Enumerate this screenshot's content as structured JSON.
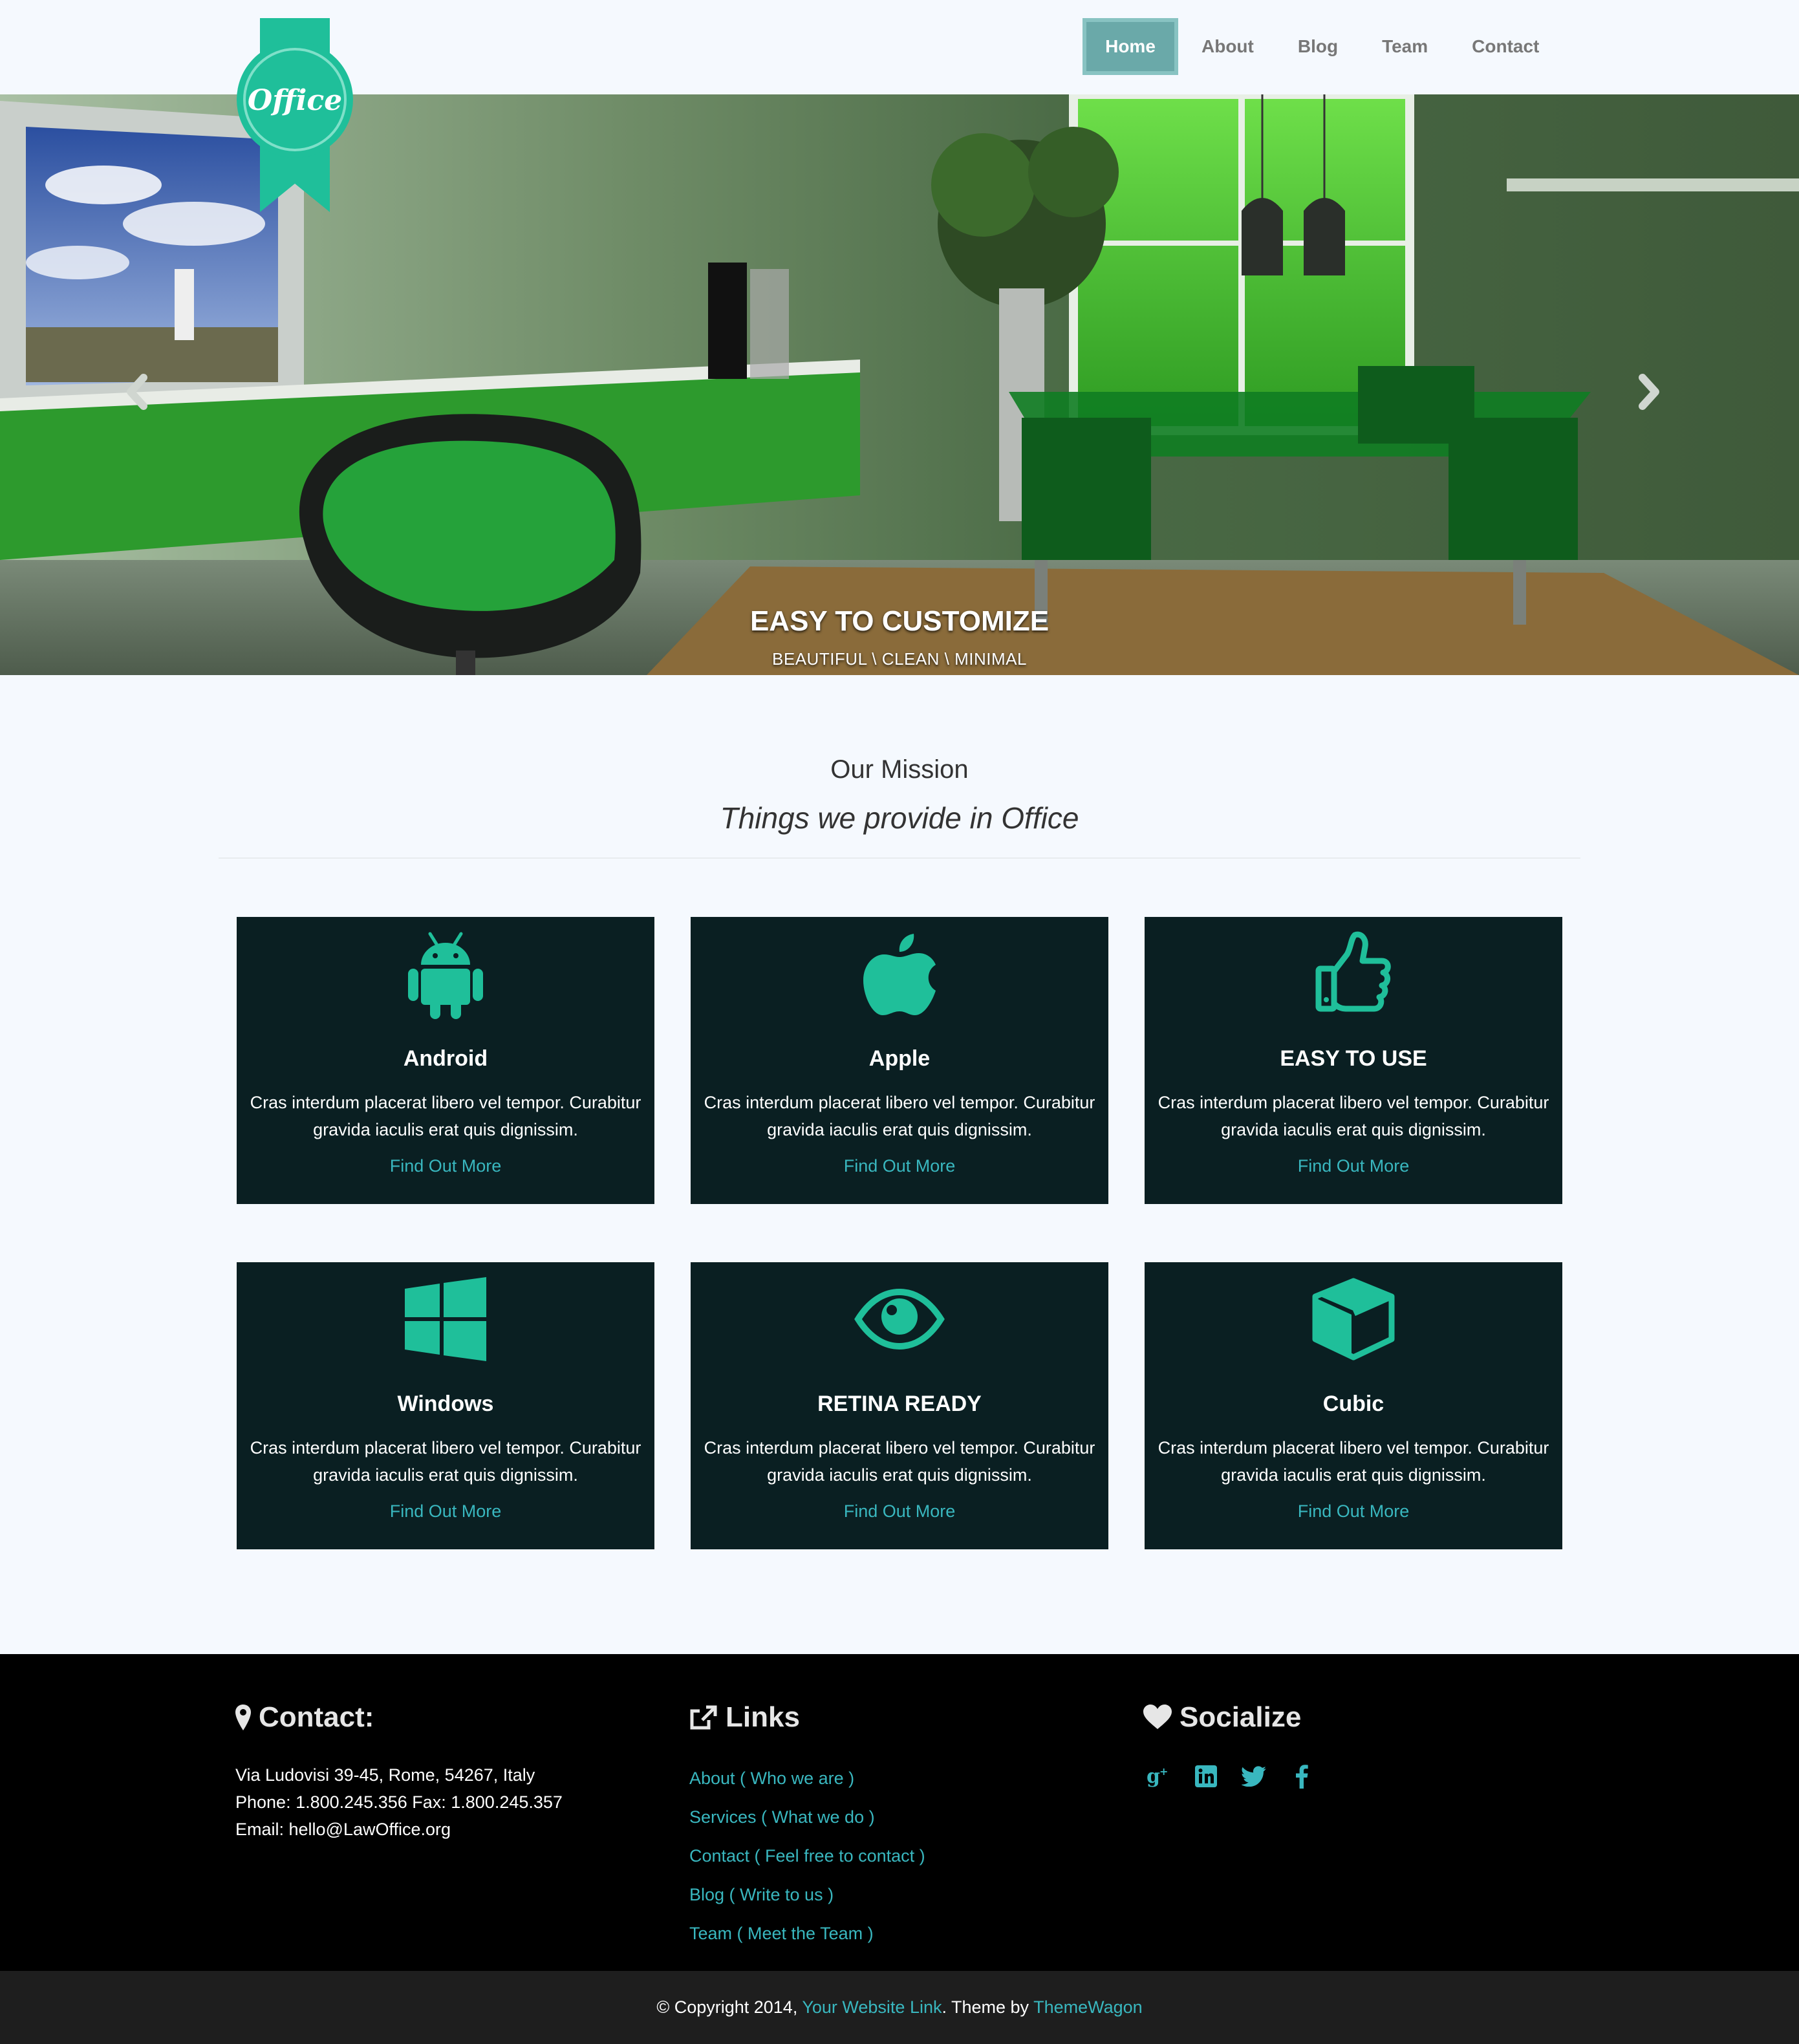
{
  "brand": {
    "logo_text": "Office",
    "accent": "#1fbf9a",
    "link_color": "#39b7bf",
    "card_bg": "#0a1f22"
  },
  "nav": {
    "items": [
      {
        "label": "Home",
        "active": true
      },
      {
        "label": "About"
      },
      {
        "label": "Blog"
      },
      {
        "label": "Team"
      },
      {
        "label": "Contact"
      }
    ]
  },
  "hero": {
    "title": "EASY TO CUSTOMIZE",
    "subtitle": "BEAUTIFUL \\ CLEAN \\ MINIMAL",
    "prev_icon": "chevron-left-icon",
    "next_icon": "chevron-right-icon"
  },
  "mission": {
    "title": "Our Mission",
    "subtitle": "Things we provide in Office",
    "cards": [
      {
        "icon": "android-icon",
        "title": "Android",
        "text": "Cras interdum placerat libero vel tempor. Curabitur gravida iaculis erat quis dignissim.",
        "link": "Find Out More"
      },
      {
        "icon": "apple-icon",
        "title": "Apple",
        "text": "Cras interdum placerat libero vel tempor. Curabitur gravida iaculis erat quis dignissim.",
        "link": "Find Out More"
      },
      {
        "icon": "thumbs-up-icon",
        "title": "EASY TO USE",
        "text": "Cras interdum placerat libero vel tempor. Curabitur gravida iaculis erat quis dignissim.",
        "link": "Find Out More"
      },
      {
        "icon": "windows-icon",
        "title": "Windows",
        "text": "Cras interdum placerat libero vel tempor. Curabitur gravida iaculis erat quis dignissim.",
        "link": "Find Out More"
      },
      {
        "icon": "eye-icon",
        "title": "RETINA READY",
        "text": "Cras interdum placerat libero vel tempor. Curabitur gravida iaculis erat quis dignissim.",
        "link": "Find Out More"
      },
      {
        "icon": "cube-icon",
        "title": "Cubic",
        "text": "Cras interdum placerat libero vel tempor. Curabitur gravida iaculis erat quis dignissim.",
        "link": "Find Out More"
      }
    ]
  },
  "footer": {
    "contact": {
      "heading": "Contact:",
      "icon": "map-marker-icon",
      "address": "Via Ludovisi 39-45, Rome, 54267, Italy",
      "phone": "Phone: 1.800.245.356 Fax: 1.800.245.357",
      "email": "Email: hello@LawOffice.org"
    },
    "links": {
      "heading": "Links",
      "icon": "external-link-icon",
      "items": [
        "About ( Who we are )",
        "Services ( What we do )",
        "Contact ( Feel free to contact )",
        "Blog ( Write to us )",
        "Team ( Meet the Team )"
      ]
    },
    "social": {
      "heading": "Socialize",
      "icon": "heart-icon",
      "networks": [
        "google-plus-icon",
        "linkedin-icon",
        "twitter-icon",
        "facebook-icon"
      ]
    }
  },
  "copyright": {
    "prefix": "© Copyright 2014, ",
    "site_link": "Your Website Link",
    "middle": ". Theme by ",
    "theme_link": "ThemeWagon"
  }
}
